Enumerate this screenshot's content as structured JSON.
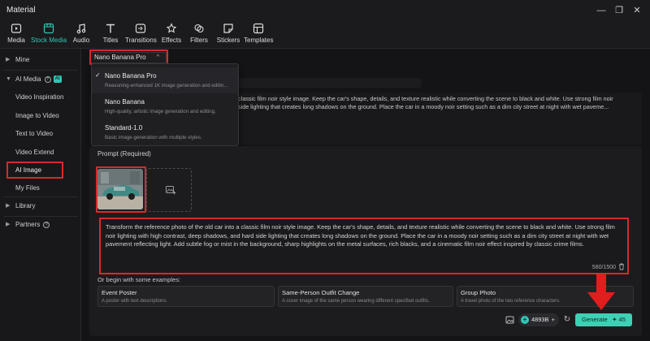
{
  "window": {
    "title": "Material",
    "minimize": "—",
    "restore": "❐",
    "close": "✕"
  },
  "toolbar": {
    "tabs": [
      {
        "label": "Media",
        "icon": "media-icon"
      },
      {
        "label": "Stock Media",
        "icon": "stock-media-icon",
        "active": true
      },
      {
        "label": "Audio",
        "icon": "audio-icon"
      },
      {
        "label": "Titles",
        "icon": "titles-icon"
      },
      {
        "label": "Transitions",
        "icon": "transitions-icon"
      },
      {
        "label": "Effects",
        "icon": "effects-icon"
      },
      {
        "label": "Filters",
        "icon": "filters-icon"
      },
      {
        "label": "Stickers",
        "icon": "stickers-icon"
      },
      {
        "label": "Templates",
        "icon": "templates-icon"
      }
    ]
  },
  "sidebar": {
    "mine": "Mine",
    "ai_media": "AI Media",
    "ai_badge": "AI",
    "info": "?",
    "sub_items": [
      "Video Inspiration",
      "Image to Video",
      "Text to Video",
      "Video Extend",
      "AI Image",
      "My Files"
    ],
    "library": "Library",
    "partners": "Partners"
  },
  "model_select": {
    "value": "Nano Banana Pro",
    "caret": "^"
  },
  "dropdown": {
    "options": [
      {
        "name": "Nano Banana Pro",
        "desc": "Reasoning-enhanced 1K image generation and editin...",
        "selected": true
      },
      {
        "name": "Nano Banana",
        "desc": "High-quality, artistic image generation and editing."
      },
      {
        "name": "Standard-1.0",
        "desc": "Basic image generation with multiple styles."
      }
    ]
  },
  "background_prompt": {
    "line1": "classic film noir style image. Keep the car's shape, details, and texture realistic while converting the scene to black and white. Use strong film noir",
    "line2": "side lighting that creates long shadows on the ground. Place the car in a moody noir setting such as a dim city street at night with wet paveme..."
  },
  "prompt": {
    "label": "Prompt (Required)",
    "text": "Transform the reference photo of the old car into a classic film noir style image. Keep the car's shape, details, and texture realistic while converting the scene to black and white. Use strong film noir lighting with high contrast, deep shadows, and hard side lighting that creates long shadows on the ground. Place the car in a moody noir setting such as a dim city street at night with wet pavement reflecting light. Add subtle fog or mist in the background, sharp highlights on the metal surfaces, rich blacks, and a cinematic film noir effect inspired by classic crime films.",
    "count": "580/1500"
  },
  "examples": {
    "label": "Or begin with some examples:",
    "cards": [
      {
        "title": "Event Poster",
        "desc": "A poster with text descriptions."
      },
      {
        "title": "Same-Person Outfit Change",
        "desc": "A cover image of the same person wearing different specified outfits."
      },
      {
        "title": "Group Photo",
        "desc": "A travel photo of the two reference characters."
      }
    ]
  },
  "footer": {
    "credits": "4893B",
    "credits_plus": "+",
    "generate_label": "Generate",
    "generate_cost": "✦ 45"
  },
  "colors": {
    "accent": "#2fc6b5",
    "generate": "#3ed0b4",
    "highlight": "#d62b2b"
  }
}
